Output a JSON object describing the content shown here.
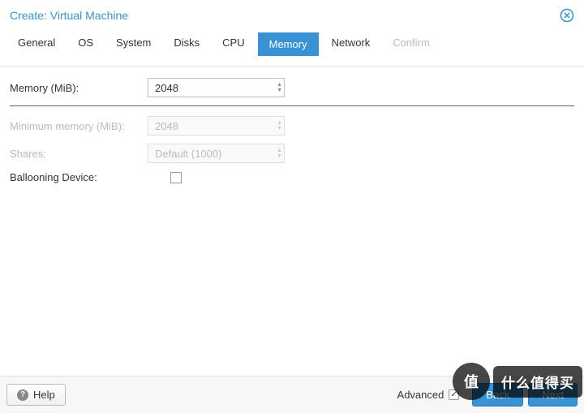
{
  "header": {
    "title": "Create: Virtual Machine"
  },
  "tabs": {
    "general": "General",
    "os": "OS",
    "system": "System",
    "disks": "Disks",
    "cpu": "CPU",
    "memory": "Memory",
    "network": "Network",
    "confirm": "Confirm"
  },
  "form": {
    "memory_label": "Memory (MiB):",
    "memory_value": "2048",
    "min_memory_label": "Minimum memory (MiB):",
    "min_memory_value": "2048",
    "shares_label": "Shares:",
    "shares_value": "Default (1000)",
    "ballooning_label": "Ballooning Device:"
  },
  "footer": {
    "help": "Help",
    "advanced": "Advanced",
    "back": "Back",
    "next": "Next"
  },
  "watermark": {
    "circle": "值",
    "text": "什么值得买"
  }
}
